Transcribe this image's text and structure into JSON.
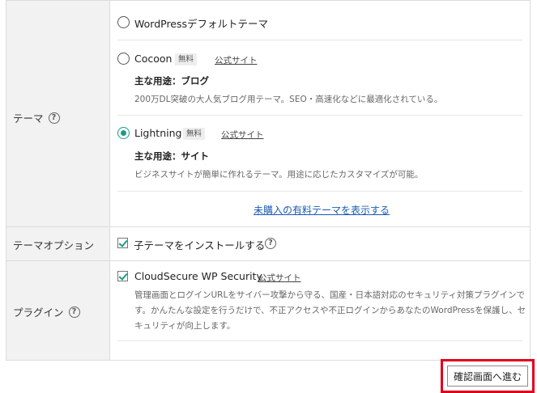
{
  "rows": {
    "theme_label": "テーマ",
    "theme_option_label": "テーマオプション",
    "plugin_label": "プラグイン"
  },
  "themes": [
    {
      "name": "WordPressデフォルトテーマ",
      "selected": false
    },
    {
      "name": "Cocoon",
      "badge": "無料",
      "official_link": "公式サイト",
      "usage": "主な用途：ブログ",
      "description": "200万DL突破の大人気ブログ用テーマ。SEO・高速化などに最適化されている。",
      "selected": false
    },
    {
      "name": "Lightning",
      "badge": "無料",
      "official_link": "公式サイト",
      "usage": "主な用途：サイト",
      "description": "ビジネスサイトが簡単に作れるテーマ。用途に応じたカスタマイズが可能。",
      "selected": true
    }
  ],
  "show_paid_link": "未購入の有料テーマを表示する",
  "theme_option": {
    "label": "子テーマをインストールする",
    "checked": true
  },
  "plugin": {
    "name": "CloudSecure WP Security",
    "official_link": "公式サイト",
    "checked": true,
    "description": "管理画面とログインURLをサイバー攻撃から守る、国産・日本語対応のセキュリティ対策プラグインです。かんたんな設定を行うだけで、不正アクセスや不正ログインからあなたのWordPressを保護し、セキュリティが向上します。"
  },
  "confirm_button": "確認画面へ進む",
  "help_symbol": "?",
  "colors": {
    "accent": "#1a9a8a",
    "link": "#1a5bb5",
    "highlight": "#e0001a"
  }
}
